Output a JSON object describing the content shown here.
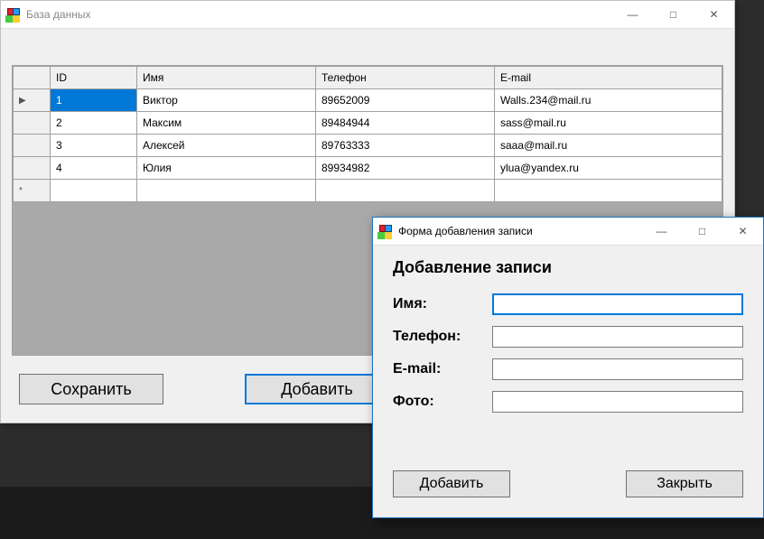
{
  "main": {
    "title": "База данных",
    "columns": {
      "id": "ID",
      "name": "Имя",
      "phone": "Телефон",
      "email": "E-mail"
    },
    "rows": [
      {
        "id": "1",
        "name": "Виктор",
        "phone": "89652009",
        "email": "Walls.234@mail.ru",
        "selected_col": "id",
        "current": true
      },
      {
        "id": "2",
        "name": "Максим",
        "phone": "89484944",
        "email": "sass@mail.ru"
      },
      {
        "id": "3",
        "name": "Алексей",
        "phone": "89763333",
        "email": "saaa@mail.ru"
      },
      {
        "id": "4",
        "name": "Юлия",
        "phone": "89934982",
        "email": "ylua@yandex.ru"
      }
    ],
    "buttons": {
      "save": "Сохранить",
      "add": "Добавить"
    }
  },
  "dialog": {
    "title": "Форма добавления записи",
    "heading": "Добавление записи",
    "labels": {
      "name": "Имя:",
      "phone": "Телефон:",
      "email": "E-mail:",
      "photo": "Фото:"
    },
    "values": {
      "name": "",
      "phone": "",
      "email": "",
      "photo": ""
    },
    "buttons": {
      "add": "Добавить",
      "close": "Закрыть"
    }
  },
  "window_controls": {
    "minimize": "—",
    "maximize": "□",
    "close": "✕"
  }
}
